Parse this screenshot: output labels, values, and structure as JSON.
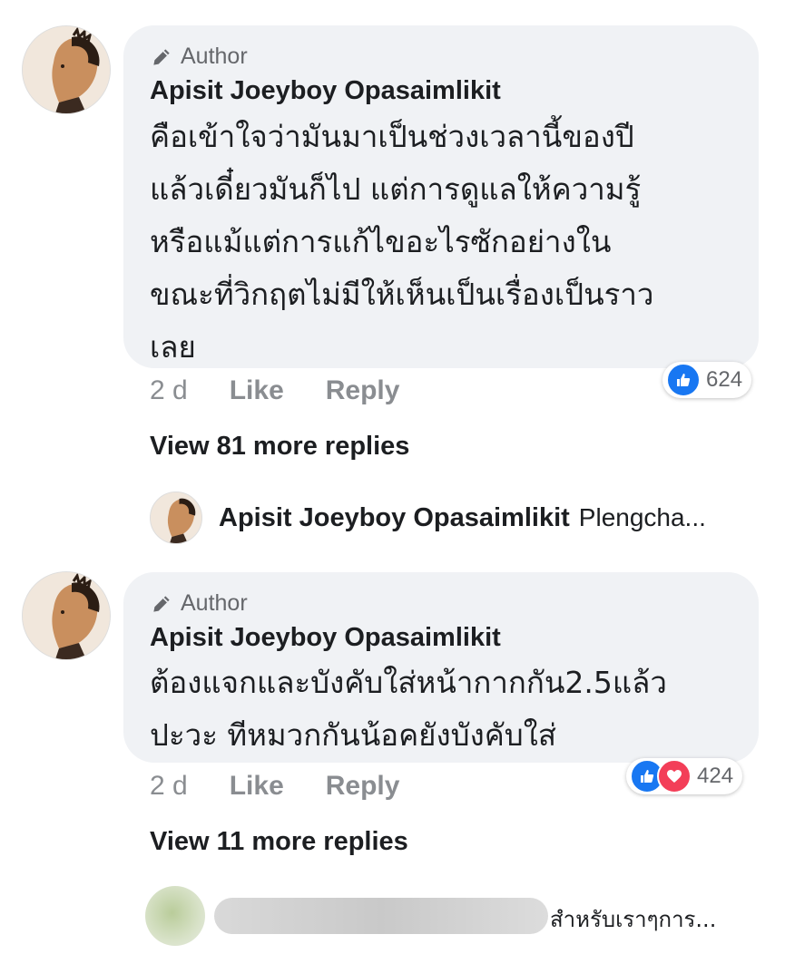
{
  "comments": [
    {
      "author_badge": "Author",
      "name": "Apisit Joeyboy Opasaimlikit",
      "text_lines": [
        "คือเข้าใจว่ามันมาเป็นช่วงเวลานี้ของปี",
        "แล้วเดี๋ยวมันก็ไป แต่การดูแลให้ความรู้",
        "หรือแม้แต่การแก้ไขอะไรซักอย่างใน",
        "ขณะที่วิกฤตไม่มีให้เห็นเป็นเรื่องเป็นราว",
        "เลย"
      ],
      "time": "2 d",
      "like_label": "Like",
      "reply_label": "Reply",
      "reaction_count": "624",
      "reactions": [
        "like-icon"
      ],
      "view_more": "View 81 more replies",
      "reply_preview": {
        "name": "Apisit Joeyboy Opasaimlikit",
        "text": "Plengcha..."
      }
    },
    {
      "author_badge": "Author",
      "name": "Apisit Joeyboy Opasaimlikit",
      "text_lines": [
        "ต้องแจกและบังคับใส่หน้ากากกัน2.5แล้ว",
        "ปะวะ ทีหมวกกันน้อคยังบังคับใส่"
      ],
      "time": "2 d",
      "like_label": "Like",
      "reply_label": "Reply",
      "reaction_count": "424",
      "reactions": [
        "like-icon",
        "love-icon"
      ],
      "view_more": "View 11 more replies"
    }
  ],
  "next_comment": {
    "text": "สำหรับเราๆการ..."
  },
  "colors": {
    "bubble": "#f0f2f5",
    "like_blue": "#1877f2",
    "love_red": "#f33e58",
    "muted": "#65676b"
  }
}
